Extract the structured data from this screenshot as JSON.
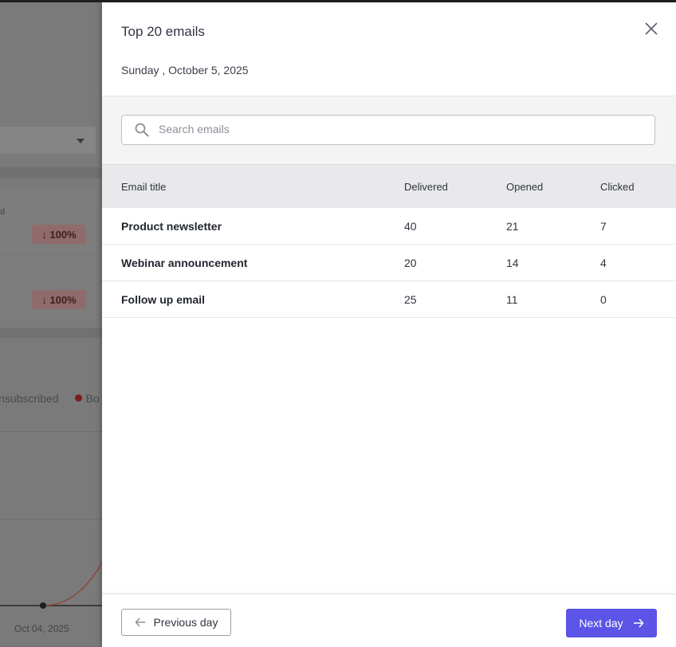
{
  "background": {
    "stub_text": "d",
    "badge_1": "↓ 100%",
    "badge_2": "↓ 100%",
    "legend_unsubscribed": "Unsubscribed",
    "legend_bounced": "Bo",
    "axis_date": "Oct 04, 2025"
  },
  "drawer": {
    "title": "Top 20 emails",
    "date": "Sunday , October 5, 2025",
    "search": {
      "placeholder": "Search emails",
      "value": ""
    },
    "columns": {
      "title": "Email title",
      "delivered": "Delivered",
      "opened": "Opened",
      "clicked": "Clicked"
    },
    "rows": [
      {
        "title": "Product newsletter",
        "delivered": "40",
        "opened": "21",
        "clicked": "7"
      },
      {
        "title": "Webinar announcement",
        "delivered": "20",
        "opened": "14",
        "clicked": "4"
      },
      {
        "title": "Follow up email",
        "delivered": "25",
        "opened": "11",
        "clicked": "0"
      }
    ],
    "footer": {
      "previous_label": "Previous day",
      "next_label": "Next day"
    }
  },
  "colors": {
    "accent": "#5b54e6",
    "overlay": "#7a7a7a",
    "badge": "#8f6b6b"
  },
  "icons": {
    "close": "close-icon",
    "search": "search-icon",
    "previous": "arrow-left-icon",
    "next": "arrow-right-icon"
  }
}
